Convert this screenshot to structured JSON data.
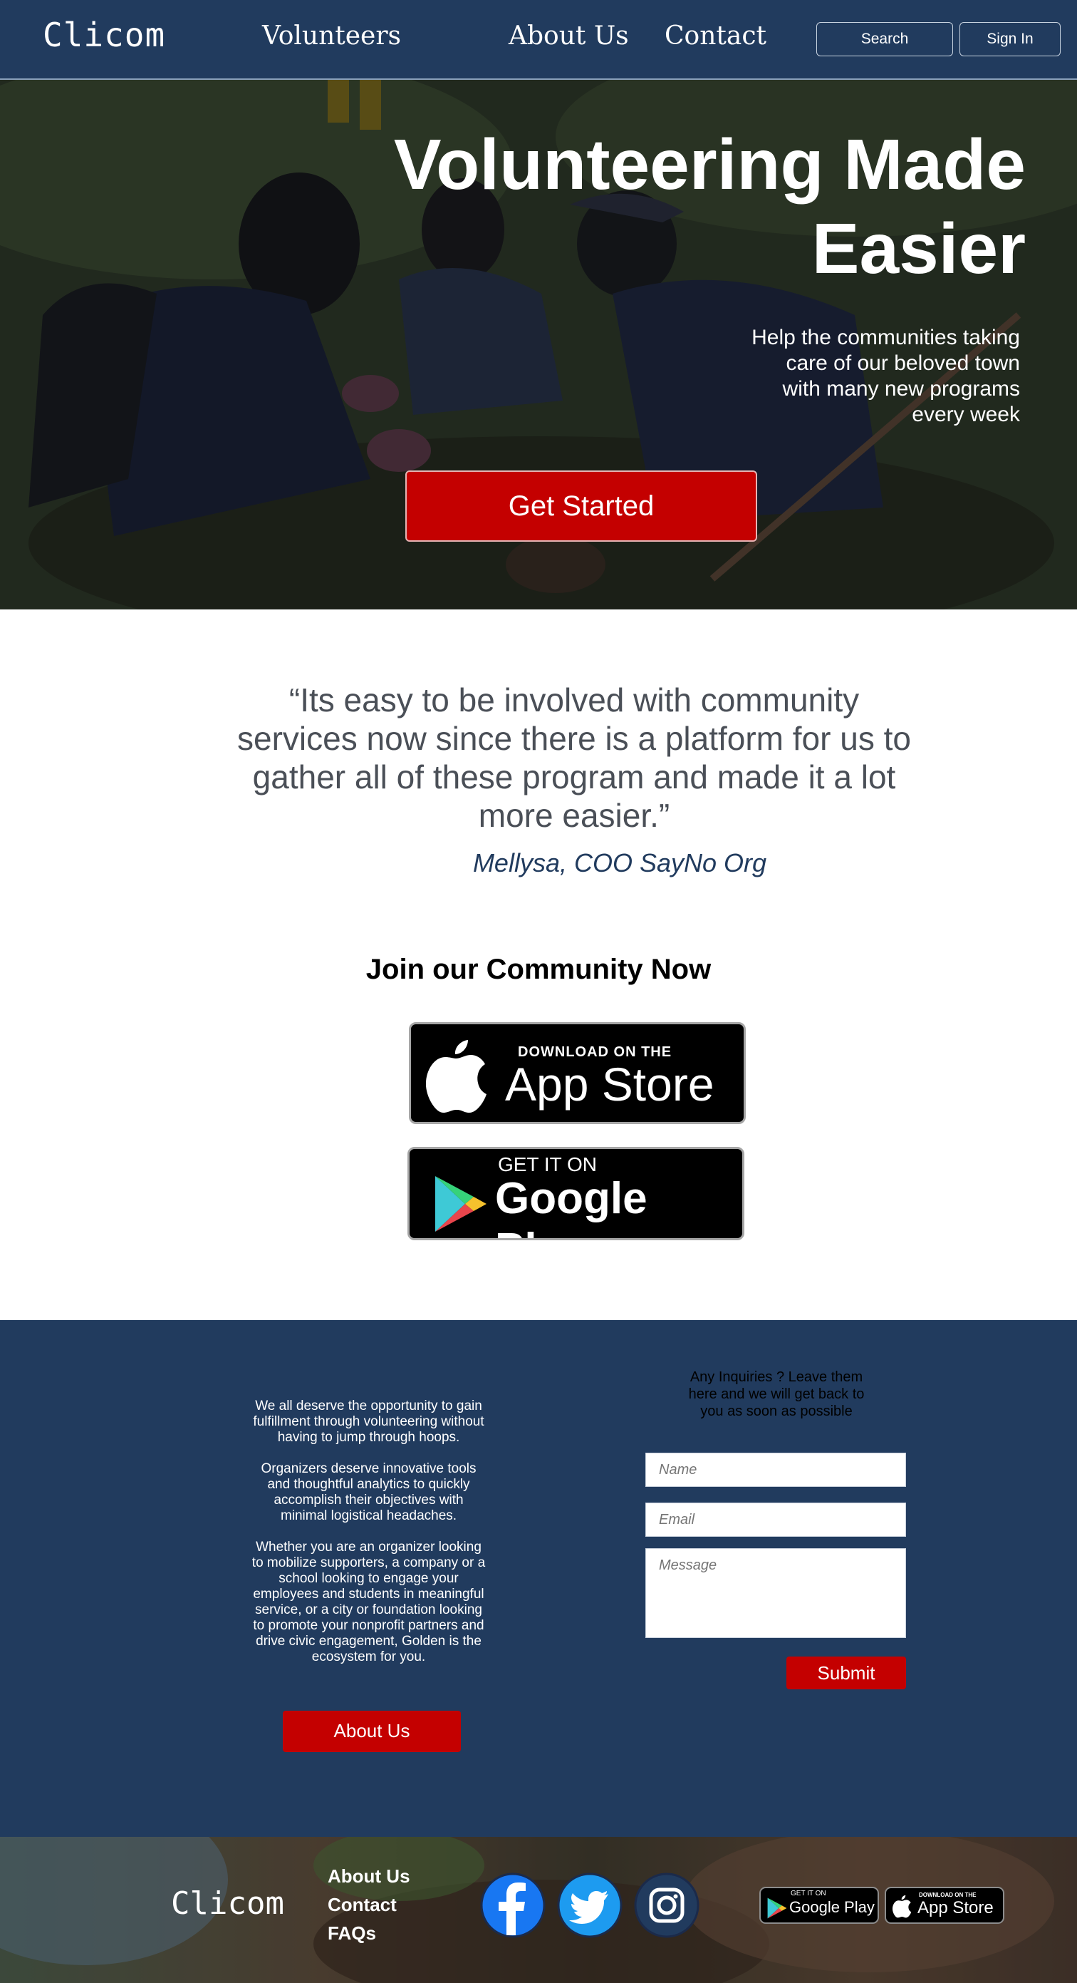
{
  "nav": {
    "logo": "Clicom",
    "links": [
      "Volunteers",
      "About Us",
      "Contact"
    ],
    "search_label": "Search",
    "signin_label": "Sign In"
  },
  "hero": {
    "title_line1": "Volunteering Made",
    "title_line2": "Easier",
    "subtitle": "Help the communities taking care of our beloved town with many new programs every week",
    "cta_label": "Get Started"
  },
  "testimonial": {
    "quote": "“Its easy to be involved with community services now since there is a platform for us to gather all of these program and made it a lot more easier.”",
    "author": "Mellysa, COO SayNo Org"
  },
  "join": {
    "heading": "Join our Community Now",
    "app_store": {
      "top": "DOWNLOAD ON THE",
      "main": "App Store"
    },
    "google_play": {
      "top": "GET IT ON",
      "main": "Google Play"
    }
  },
  "about": {
    "paragraphs": [
      "We all deserve the opportunity to gain fulfillment through volunteering without having to jump through hoops.",
      "Organizers deserve innovative tools and thoughtful analytics to quickly accomplish their objectives with minimal logistical headaches.",
      "Whether you are an organizer looking to mobilize supporters, a company or a school looking to engage your employees and students in meaningful service, or a city or foundation looking to promote your nonprofit partners and drive civic engagement, Golden is the ecosystem for you."
    ],
    "button_label": "About Us"
  },
  "contact": {
    "heading": "Any Inquiries ? Leave them here and we will get back to you as soon as possible",
    "name_placeholder": "Name",
    "email_placeholder": "Email",
    "message_placeholder": "Message",
    "submit_label": "Submit"
  },
  "footer": {
    "logo": "Clicom",
    "links": [
      "About Us",
      "Contact",
      "FAQs"
    ],
    "social": [
      "facebook-icon",
      "twitter-icon",
      "instagram-icon"
    ],
    "google_play": {
      "top": "GET IT ON",
      "main": "Google Play"
    },
    "app_store": {
      "top": "DOWNLOAD ON THE",
      "main": "App Store"
    }
  },
  "colors": {
    "navy": "#213b5e",
    "red": "#c40000",
    "quote_gray": "#4a4f57"
  }
}
